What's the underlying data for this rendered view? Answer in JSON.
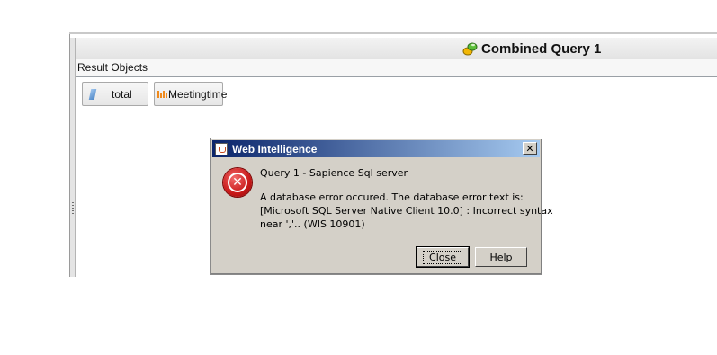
{
  "query_panel": {
    "title": "Combined Query 1",
    "title_icon": "combined-query-icon",
    "result_objects_label": "Result Objects",
    "objects": [
      {
        "label": "total",
        "icon": "measure-icon"
      },
      {
        "label": "Meetingtime",
        "icon": "dimension-icon"
      }
    ]
  },
  "dialog": {
    "title": "Web Intelligence",
    "title_icon": "java-cup-icon",
    "close_glyph": "✕",
    "error_icon": "error-icon",
    "query_name": "Query 1 - Sapience Sql server",
    "message_lines": [
      "A database error occured. The database error text is:",
      "[Microsoft SQL Server Native Client 10.0] : Incorrect syntax",
      "near ','.. (WIS 10901)"
    ],
    "buttons": {
      "close": "Close",
      "help": "Help"
    }
  },
  "colors": {
    "dialog_bg": "#d4d0c8",
    "titlebar_start": "#0a246a",
    "titlebar_end": "#a6caf0",
    "error_red": "#c81818"
  }
}
